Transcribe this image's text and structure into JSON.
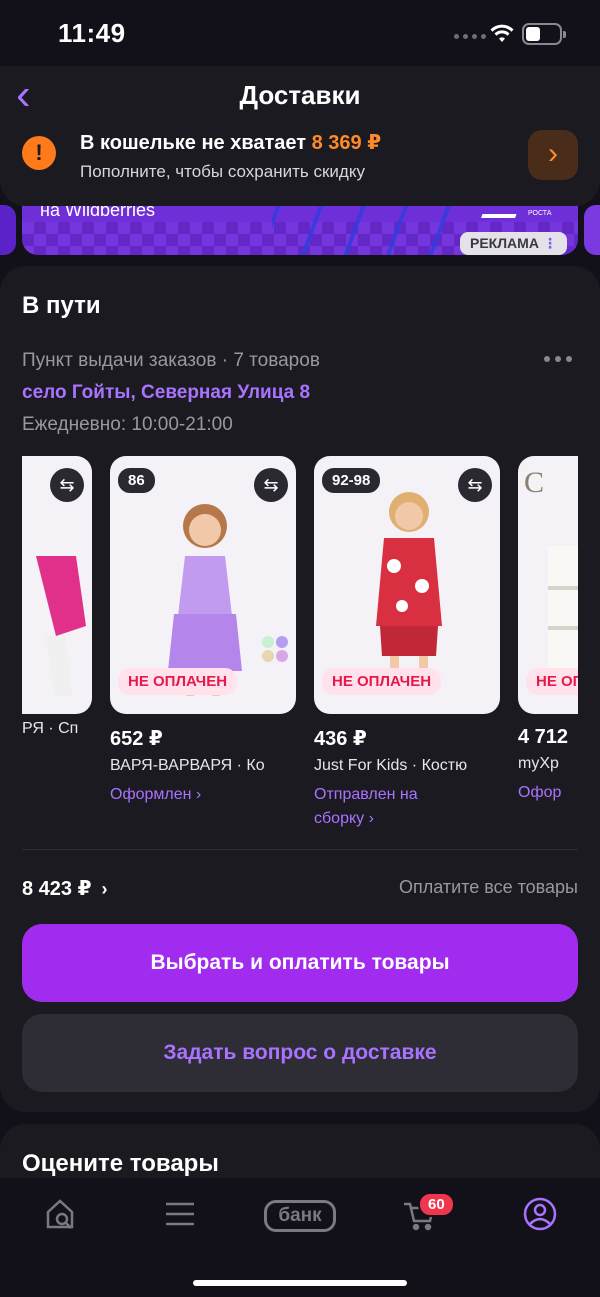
{
  "status_bar": {
    "time": "11:49"
  },
  "header": {
    "title": "Доставки",
    "wallet": {
      "title": "В кошельке не хватает",
      "amount": "8 369 ₽",
      "subtitle": "Пополните, чтобы сохранить скидку"
    }
  },
  "ad": {
    "text": "на Wildberries",
    "logo_caption": "ПЛАТФОРМА РОСТА",
    "label": "РЕКЛАМА"
  },
  "transit": {
    "title": "В пути",
    "pickup": "Пункт выдачи заказов · 7 товаров",
    "address": "село Гойты, Северная Улица 8",
    "hours": "Ежедневно: 10:00-21:00",
    "products": [
      {
        "price": "",
        "name": "РЯ · Сп",
        "status": "",
        "badge": "",
        "size": ""
      },
      {
        "price": "652 ₽",
        "name": "ВАРЯ-ВАРВАРЯ · Ко",
        "status": "Оформлен ›",
        "badge": "НЕ ОПЛАЧЕН",
        "size": "86"
      },
      {
        "price": "436 ₽",
        "name": "Just For Kids · Костю",
        "status": "Отправлен на сборку ›",
        "badge": "НЕ ОПЛАЧЕН",
        "size": "92-98"
      },
      {
        "price": "4 712",
        "name": "myXp",
        "status": "Офор",
        "badge": "НЕ ОП",
        "size": ""
      }
    ],
    "total": "8 423 ₽",
    "pay_all": "Оплатите все товары",
    "primary_button": "Выбрать и оплатить товары",
    "secondary_button": "Задать вопрос о доставке"
  },
  "rate": {
    "title": "Оцените товары"
  },
  "tabbar": {
    "bank_label": "банк",
    "cart_badge": "60"
  }
}
